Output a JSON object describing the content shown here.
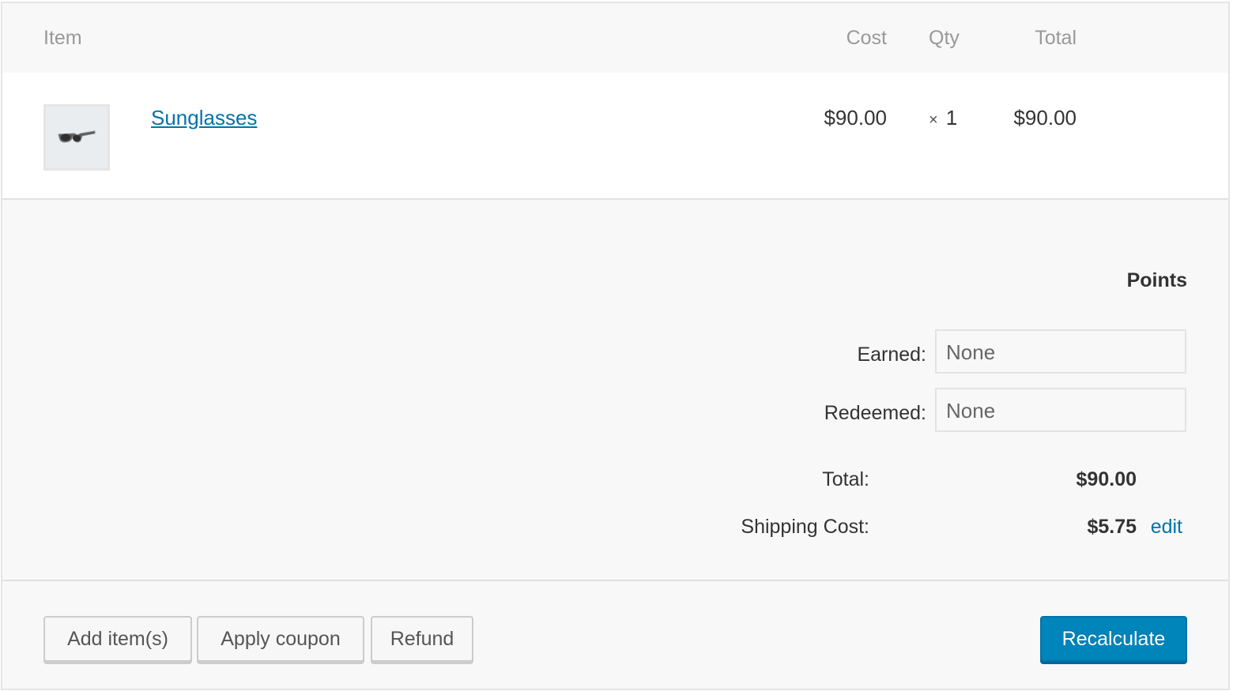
{
  "table": {
    "headers": {
      "item": "Item",
      "cost": "Cost",
      "qty": "Qty",
      "total": "Total"
    },
    "rows": [
      {
        "name": "Sunglasses",
        "thumbnail_icon": "sunglasses-icon",
        "cost": "$90.00",
        "qty_prefix": "×",
        "qty": "1",
        "total": "$90.00"
      }
    ]
  },
  "points": {
    "title": "Points",
    "earned_label": "Earned:",
    "earned_value": "None",
    "redeemed_label": "Redeemed:",
    "redeemed_value": "None"
  },
  "summary": {
    "total_label": "Total:",
    "total_value": "$90.00",
    "shipping_label": "Shipping Cost:",
    "shipping_value": "$5.75",
    "shipping_edit": "edit"
  },
  "actions": {
    "add_items": "Add item(s)",
    "apply_coupon": "Apply coupon",
    "refund": "Refund",
    "recalculate": "Recalculate"
  },
  "colors": {
    "link": "#0073aa",
    "primary": "#0085ba"
  }
}
